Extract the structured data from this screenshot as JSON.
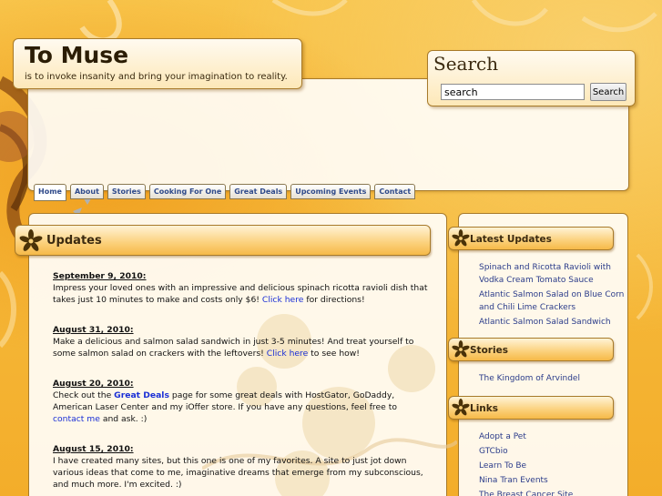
{
  "site": {
    "title": "To Muse",
    "tagline": "is to invoke insanity and bring your imagination to reality."
  },
  "search": {
    "heading": "Search",
    "value": "search",
    "button_label": "Search"
  },
  "nav": {
    "tabs": [
      {
        "label": "Home",
        "active": true
      },
      {
        "label": "About"
      },
      {
        "label": "Stories"
      },
      {
        "label": "Cooking For One"
      },
      {
        "label": "Great Deals"
      },
      {
        "label": "Upcoming Events"
      },
      {
        "label": "Contact"
      }
    ]
  },
  "updates": {
    "heading": "Updates",
    "posts": [
      {
        "date": "September 9, 2010:",
        "text_before": "Impress your loved ones with an impressive and delicious spinach ricotta ravioli dish that takes just 10 minutes to make and costs only $6! ",
        "link": "Click here",
        "text_after": " for directions!"
      },
      {
        "date": "August 31, 2010:",
        "text_before": "Make a delicious and salmon salad sandwich in just 3-5 minutes! And treat yourself to some salmon salad on crackers with the leftovers! ",
        "link": "Click here",
        "text_after": " to see how!"
      },
      {
        "date": "August 20, 2010:",
        "text_before": "Check out the ",
        "link": "Great Deals",
        "text_middle": " page for some great deals with HostGator, GoDaddy, American Laser Center and my iOffer store. If you have any questions, feel free to ",
        "link2": "contact me",
        "text_after": " and ask. :)"
      },
      {
        "date": "August 15, 2010:",
        "text_before": "I have created many sites, but this one is one of my favorites. A site to just jot down various ideas that come to me, imaginative dreams that emerge from my subconscious, and much more. I'm excited. :)"
      }
    ]
  },
  "sidebar": {
    "latest": {
      "heading": "Latest Updates",
      "items": [
        "Spinach and Ricotta Ravioli with Vodka Cream Tomato Sauce",
        "Atlantic Salmon Salad on Blue Corn and Chili Lime Crackers",
        "Atlantic Salmon Salad Sandwich"
      ]
    },
    "stories": {
      "heading": "Stories",
      "items": [
        "The Kingdom of Arvindel"
      ]
    },
    "links": {
      "heading": "Links",
      "items": [
        "Adopt a Pet",
        "GTCbio",
        "Learn To Be",
        "Nina Tran Events",
        "The Breast Cancer Site"
      ]
    }
  },
  "colors": {
    "background": "#f5b632",
    "link": "#1a2fd6",
    "sidebar_link": "#2b3c8a",
    "panel_border": "#a77a2a"
  },
  "icons": {
    "section_marker": "flower-star-icon"
  }
}
